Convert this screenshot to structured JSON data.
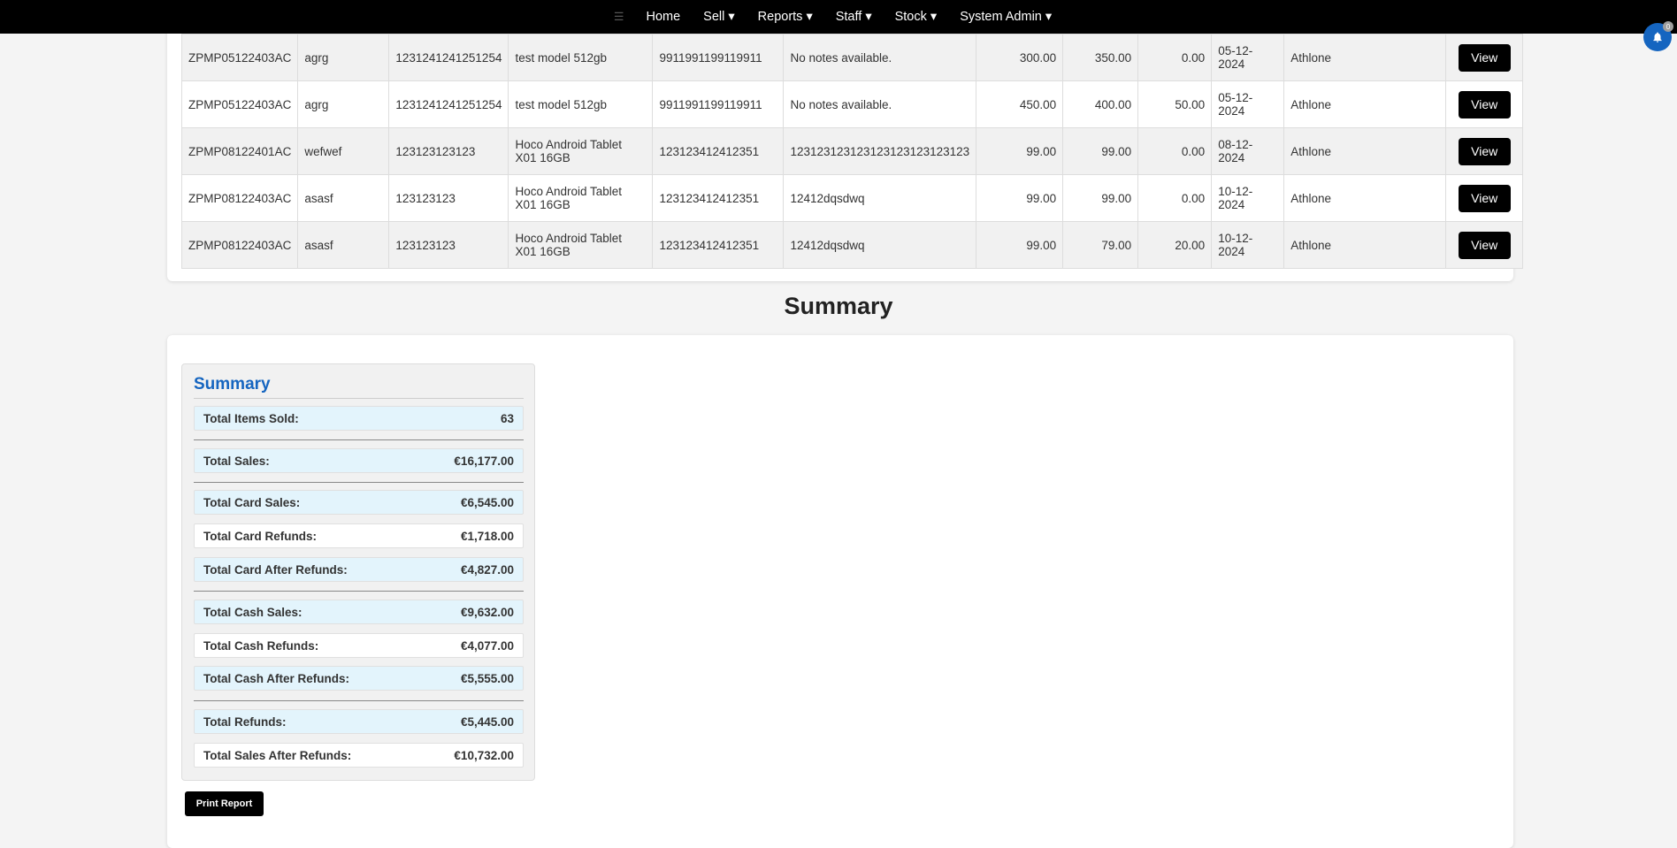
{
  "nav": {
    "items": [
      "Home",
      "Sell ▾",
      "Reports ▾",
      "Staff ▾",
      "Stock ▾",
      "System Admin ▾"
    ]
  },
  "records": {
    "view_label": "View",
    "rows": [
      [
        "ZPMP05122403AC",
        "agrg",
        "1231241241251254",
        "test model 512gb",
        "9911991199119911",
        "No notes available.",
        "300.00",
        "350.00",
        "0.00",
        "05-12-2024",
        "Athlone"
      ],
      [
        "ZPMP05122403AC",
        "agrg",
        "1231241241251254",
        "test model 512gb",
        "9911991199119911",
        "No notes available.",
        "450.00",
        "400.00",
        "50.00",
        "05-12-2024",
        "Athlone"
      ],
      [
        "ZPMP08122401AC",
        "wefwef",
        "123123123123",
        "Hoco Android Tablet X01 16GB",
        "123123412412351",
        "123123123123123123123123123",
        "99.00",
        "99.00",
        "0.00",
        "08-12-2024",
        "Athlone"
      ],
      [
        "ZPMP08122403AC",
        "asasf",
        "123123123",
        "Hoco Android Tablet X01 16GB",
        "123123412412351",
        "12412dqsdwq",
        "99.00",
        "99.00",
        "0.00",
        "10-12-2024",
        "Athlone"
      ],
      [
        "ZPMP08122403AC",
        "asasf",
        "123123123",
        "Hoco Android Tablet X01 16GB",
        "123123412412351",
        "12412dqsdwq",
        "99.00",
        "79.00",
        "20.00",
        "10-12-2024",
        "Athlone"
      ]
    ]
  },
  "summary": {
    "section_title": "Summary",
    "box_title": "Summary",
    "rows": [
      {
        "label": "Total Items Sold:",
        "value": "63"
      },
      {
        "label": "Total Sales:",
        "value": "€16,177.00"
      },
      {
        "label": "Total Card Sales:",
        "value": "€6,545.00"
      },
      {
        "label": "Total Card Refunds:",
        "value": "€1,718.00"
      },
      {
        "label": "Total Card After Refunds:",
        "value": "€4,827.00"
      },
      {
        "label": "Total Cash Sales:",
        "value": "€9,632.00"
      },
      {
        "label": "Total Cash Refunds:",
        "value": "€4,077.00"
      },
      {
        "label": "Total Cash After Refunds:",
        "value": "€5,555.00"
      },
      {
        "label": "Total Refunds:",
        "value": "€5,445.00"
      },
      {
        "label": "Total Sales After Refunds:",
        "value": "€10,732.00"
      }
    ],
    "print_label": "Print Report"
  },
  "notifications": {
    "badge": "0"
  },
  "colors": {
    "nav_bg": "#000000",
    "accent": "#1565c0",
    "summary_row_blue": "#e3f4fc"
  }
}
